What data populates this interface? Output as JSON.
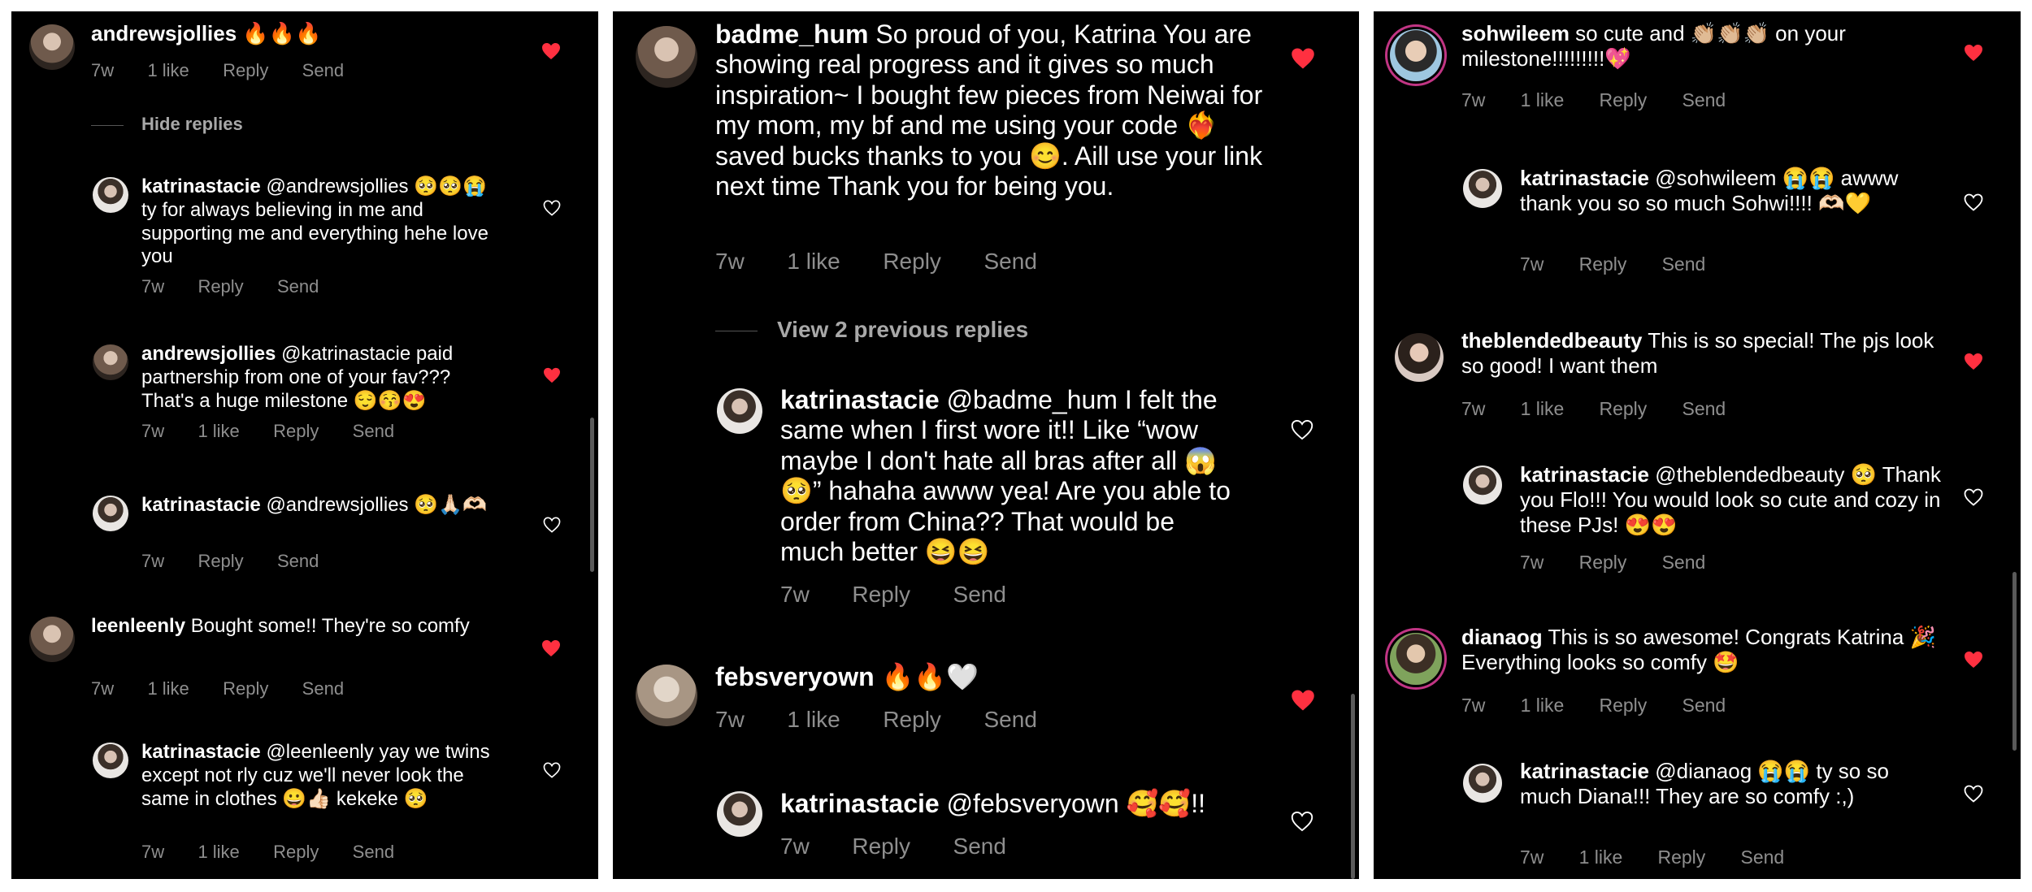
{
  "colors": {
    "background": "#000000",
    "text": "#ffffff",
    "muted": "#8e8e8e",
    "like_red": "#ff3040"
  },
  "panels": [
    {
      "comments": [
        {
          "username": "andrewsjollies",
          "text": "🔥🔥🔥",
          "time": "7w",
          "likes": "1 like",
          "reply": "Reply",
          "send": "Send",
          "liked": true
        },
        {
          "hide_replies": "Hide replies"
        },
        {
          "username": "katrinastacie",
          "text": "@andrewsjollies 🥺🥺😭 ty for always believing in me and supporting me and everything hehe love you",
          "time": "7w",
          "reply": "Reply",
          "send": "Send",
          "liked": false
        },
        {
          "username": "andrewsjollies",
          "text": "@katrinastacie paid partnership from one of your fav??? That's a huge milestone 😌😚😍",
          "time": "7w",
          "likes": "1 like",
          "reply": "Reply",
          "send": "Send",
          "liked": true
        },
        {
          "username": "katrinastacie",
          "text": "@andrewsjollies 🥺🙏🏻🫶🏻",
          "time": "7w",
          "reply": "Reply",
          "send": "Send",
          "liked": false
        },
        {
          "username": "leenleenly",
          "text": "Bought some!! They're so comfy",
          "time": "7w",
          "likes": "1 like",
          "reply": "Reply",
          "send": "Send",
          "liked": true
        },
        {
          "username": "katrinastacie",
          "text": "@leenleenly yay we twins except not rly cuz we'll never look the same in clothes 😀👍🏻 kekeke 🥺",
          "time": "7w",
          "likes": "1 like",
          "reply": "Reply",
          "send": "Send",
          "liked": false
        }
      ]
    },
    {
      "comments": [
        {
          "username": "badme_hum",
          "text": "So proud of you, Katrina You are showing real progress and it gives so much inspiration~ I bought few pieces from Neiwai for my mom, my bf and me using your code ❤️‍🔥 saved bucks thanks to you 😊. Aill use your link next time Thank you for being you.",
          "time": "7w",
          "likes": "1 like",
          "reply": "Reply",
          "send": "Send",
          "liked": true
        },
        {
          "view_previous": "View 2 previous replies"
        },
        {
          "username": "katrinastacie",
          "text": "@badme_hum I felt the same when I first wore it!! Like “wow maybe I don't hate all bras after all 😱🥺” hahaha awww yea! Are you able to order from China?? That would be much better 😆😆",
          "time": "7w",
          "reply": "Reply",
          "send": "Send",
          "liked": false
        },
        {
          "username": "febsveryown",
          "text": "🔥🔥🤍",
          "time": "7w",
          "likes": "1 like",
          "reply": "Reply",
          "send": "Send",
          "liked": true
        },
        {
          "username": "katrinastacie",
          "text": "@febsveryown 🥰🥰!!",
          "time": "7w",
          "reply": "Reply",
          "send": "Send",
          "liked": false
        }
      ]
    },
    {
      "comments": [
        {
          "username": "sohwileem",
          "text": "so cute and 👏🏼👏🏼👏🏼 on your milestone!!!!!!!!!💖",
          "time": "7w",
          "likes": "1 like",
          "reply": "Reply",
          "send": "Send",
          "liked": true
        },
        {
          "username": "katrinastacie",
          "text": "@sohwileem 😭😭 awww thank you so so much Sohwi!!!! 🫶🏻💛",
          "time": "7w",
          "reply": "Reply",
          "send": "Send",
          "liked": false
        },
        {
          "username": "theblendedbeauty",
          "text": "This is so special! The pjs look so good! I want them",
          "time": "7w",
          "likes": "1 like",
          "reply": "Reply",
          "send": "Send",
          "liked": true
        },
        {
          "username": "katrinastacie",
          "text": "@theblendedbeauty 🥺 Thank you Flo!!! You would look so cute and cozy in these PJs! 😍😍",
          "time": "7w",
          "reply": "Reply",
          "send": "Send",
          "liked": false
        },
        {
          "username": "dianaog",
          "text": "This is so awesome! Congrats Katrina 🎉 Everything looks so comfy 🤩",
          "time": "7w",
          "likes": "1 like",
          "reply": "Reply",
          "send": "Send",
          "liked": true
        },
        {
          "username": "katrinastacie",
          "text": "@dianaog 😭😭 ty so so much Diana!!! They are so comfy :,)",
          "time": "7w",
          "likes": "1 like",
          "reply": "Reply",
          "send": "Send",
          "liked": false
        }
      ]
    }
  ]
}
